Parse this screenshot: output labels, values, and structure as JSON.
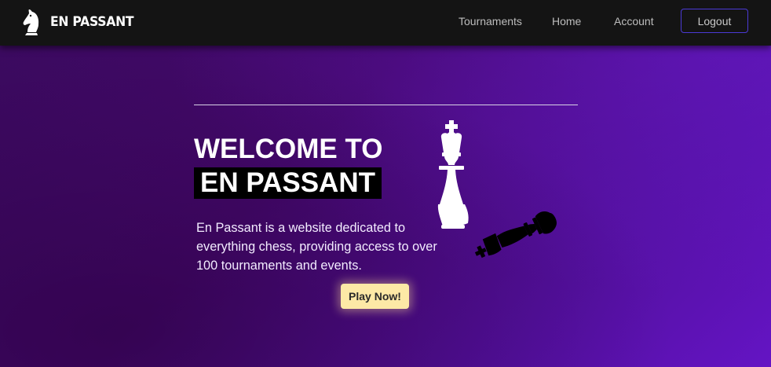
{
  "navbar": {
    "brand": "EN PASSANT",
    "brand_icon": "knight-logo-icon",
    "links": [
      {
        "label": "Tournaments"
      },
      {
        "label": "Home"
      },
      {
        "label": "Account"
      }
    ],
    "logout_label": "Logout"
  },
  "hero": {
    "title_line1": "WELCOME TO",
    "title_line2": "EN PASSANT",
    "description": "En Passant is a website dedicated to everything chess, providing access to over 100 tournaments and events.",
    "cta_label": "Play Now!",
    "illustration": "chess-kings-illustration"
  },
  "colors": {
    "navbar_bg": "#141414",
    "background_start": "#3a0a5e",
    "background_end": "#6414c4",
    "cta_bg": "#fde9a6",
    "logout_border": "#4b3ad6"
  }
}
